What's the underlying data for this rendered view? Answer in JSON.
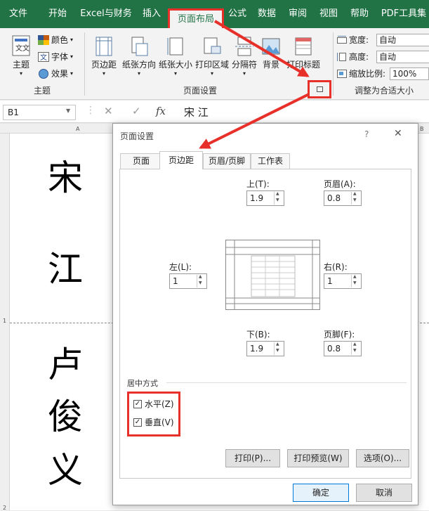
{
  "ribbon": {
    "tabs": [
      "文件",
      "开始",
      "Excel与财务",
      "插入",
      "页面布局",
      "公式",
      "数据",
      "审阅",
      "视图",
      "帮助",
      "PDF工具集"
    ],
    "active_tab": "页面布局",
    "theme_group": {
      "theme": "主题",
      "colors": "颜色",
      "fonts": "字体",
      "effects": "效果",
      "label": "主题"
    },
    "page_setup_group": {
      "buttons": [
        "页边距",
        "纸张方向",
        "纸张大小",
        "打印区域",
        "分隔符",
        "背景",
        "打印标题"
      ],
      "label": "页面设置"
    },
    "scale_group": {
      "width_label": "宽度:",
      "width_value": "自动",
      "height_label": "高度:",
      "height_value": "自动",
      "scale_label": "缩放比例:",
      "scale_value": "100%",
      "label": "调整为合适大小"
    }
  },
  "formula_bar": {
    "name_box": "B1",
    "fx": "fx",
    "value": "宋 江"
  },
  "sheet": {
    "col_headers": [
      "A",
      "B"
    ],
    "row_headers": [
      "1",
      "2"
    ],
    "chars": [
      "宋",
      "江",
      "卢",
      "俊",
      "义"
    ]
  },
  "dialog": {
    "title": "页面设置",
    "help": "?",
    "close": "✕",
    "tabs": [
      "页面",
      "页边距",
      "页眉/页脚",
      "工作表"
    ],
    "active_tab": "页边距",
    "margins": {
      "top_label": "上(T):",
      "top_value": "1.9",
      "header_label": "页眉(A):",
      "header_value": "0.8",
      "left_label": "左(L):",
      "left_value": "1",
      "right_label": "右(R):",
      "right_value": "1",
      "bottom_label": "下(B):",
      "bottom_value": "1.9",
      "footer_label": "页脚(F):",
      "footer_value": "0.8"
    },
    "center": {
      "title": "居中方式",
      "horizontal": "水平(Z)",
      "horizontal_checked": true,
      "vertical": "垂直(V)",
      "vertical_checked": true
    },
    "buttons": {
      "print": "打印(P)...",
      "preview": "打印预览(W)",
      "options": "选项(O)...",
      "ok": "确定",
      "cancel": "取消"
    }
  },
  "colors": {
    "ribbon_green": "#217346",
    "highlight_red": "#e8302a"
  }
}
